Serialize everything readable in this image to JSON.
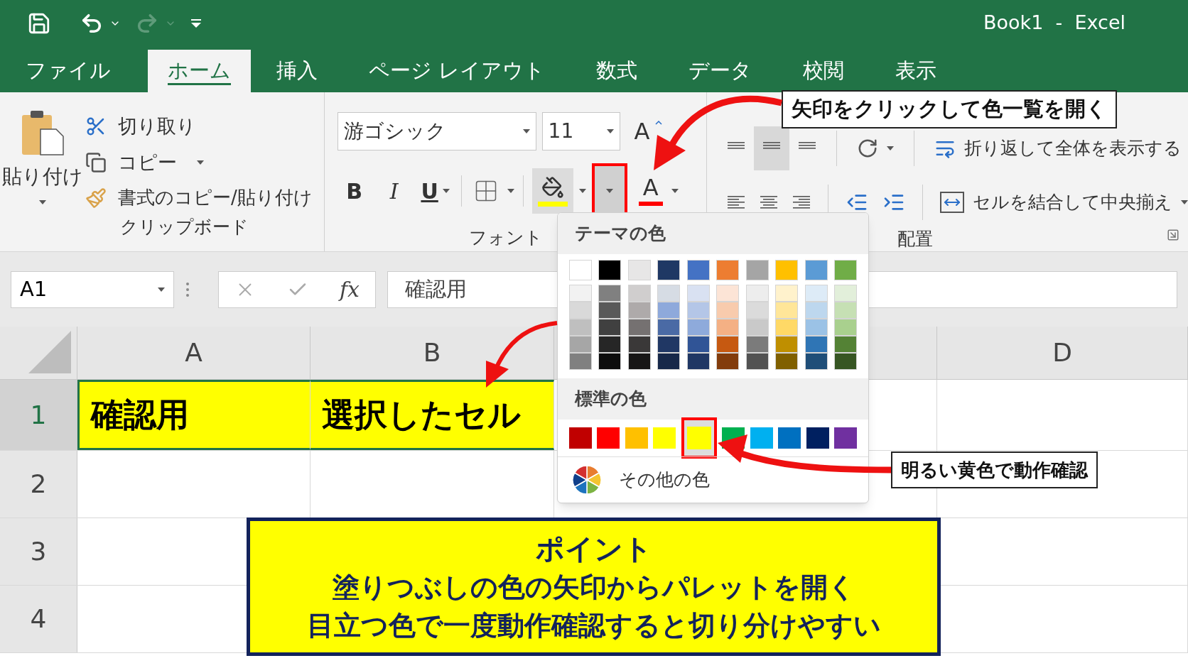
{
  "window": {
    "title": "Book1  -  Excel"
  },
  "quick_access": {
    "redo": {
      "disabled": true
    }
  },
  "tabs": [
    {
      "label": "ファイル",
      "selected": false
    },
    {
      "label": "ホーム",
      "selected": true
    },
    {
      "label": "挿入",
      "selected": false
    },
    {
      "label": "ページ レイアウト",
      "selected": false
    },
    {
      "label": "数式",
      "selected": false
    },
    {
      "label": "データ",
      "selected": false
    },
    {
      "label": "校閲",
      "selected": false
    },
    {
      "label": "表示",
      "selected": false
    }
  ],
  "ribbon": {
    "clipboard": {
      "paste": "貼り付け",
      "cut": "切り取り",
      "copy": "コピー",
      "format_painter": "書式のコピー/貼り付け",
      "label": "クリップボード"
    },
    "font": {
      "font_name": "游ゴシック",
      "font_size": "11",
      "grow_font": "A",
      "bold": "B",
      "italic": "I",
      "underline": "U",
      "fill_dropdown_highlighted": true,
      "font_color_letter": "A",
      "label": "フォント"
    },
    "alignment": {
      "wrap_text": "折り返して全体を表示する",
      "merge_center": "セルを結合して中央揃え",
      "label": "配置"
    }
  },
  "formula_bar": {
    "name_box": "A1",
    "fx": "fx",
    "value": "確認用"
  },
  "sheet": {
    "columns": [
      {
        "kind": "label",
        "label": "A"
      },
      {
        "kind": "label",
        "label": "B"
      },
      {
        "kind": "covered"
      },
      {
        "kind": "label",
        "label": "D"
      }
    ],
    "rows": [
      {
        "header": "1",
        "cells": [
          {
            "text": "確認用",
            "color": "#ffff00",
            "selected": true
          },
          {
            "text": "選択したセル",
            "color": "#ffff00",
            "selected": true
          }
        ]
      },
      {
        "header": "2"
      },
      {
        "header": "3"
      },
      {
        "header": "4"
      }
    ]
  },
  "palette": {
    "theme_title": "テーマの色",
    "theme_columns": [
      {
        "swatches": [
          {
            "color": "#ffffff"
          },
          {
            "color": "#f2f2f2"
          },
          {
            "color": "#d9d9d9"
          },
          {
            "color": "#bfbfbf"
          },
          {
            "color": "#a6a6a6"
          },
          {
            "color": "#808080"
          }
        ]
      },
      {
        "swatches": [
          {
            "color": "#000000"
          },
          {
            "color": "#808080"
          },
          {
            "color": "#595959"
          },
          {
            "color": "#404040"
          },
          {
            "color": "#262626"
          },
          {
            "color": "#0d0d0d"
          }
        ]
      },
      {
        "swatches": [
          {
            "color": "#e7e6e6"
          },
          {
            "color": "#d0cece"
          },
          {
            "color": "#aeaaaa"
          },
          {
            "color": "#757171"
          },
          {
            "color": "#3a3838"
          },
          {
            "color": "#171616"
          }
        ]
      },
      {
        "swatches": [
          {
            "color": "#1f3864"
          },
          {
            "color": "#d6dce4"
          },
          {
            "color": "#8ea9db"
          },
          {
            "color": "#4a6aa5"
          },
          {
            "color": "#203764"
          },
          {
            "color": "#172849"
          }
        ]
      },
      {
        "swatches": [
          {
            "color": "#4472c4"
          },
          {
            "color": "#d9e1f2"
          },
          {
            "color": "#b4c6e7"
          },
          {
            "color": "#8eaadb"
          },
          {
            "color": "#305496"
          },
          {
            "color": "#203764"
          }
        ]
      },
      {
        "swatches": [
          {
            "color": "#ed7d31"
          },
          {
            "color": "#fce4d6"
          },
          {
            "color": "#f8cbad"
          },
          {
            "color": "#f4b084"
          },
          {
            "color": "#c65911"
          },
          {
            "color": "#833c0c"
          }
        ]
      },
      {
        "swatches": [
          {
            "color": "#a5a5a5"
          },
          {
            "color": "#ededed"
          },
          {
            "color": "#dbdbdb"
          },
          {
            "color": "#c9c9c9"
          },
          {
            "color": "#7b7b7b"
          },
          {
            "color": "#525252"
          }
        ]
      },
      {
        "swatches": [
          {
            "color": "#ffc000"
          },
          {
            "color": "#fff2cc"
          },
          {
            "color": "#ffe699"
          },
          {
            "color": "#ffd966"
          },
          {
            "color": "#bf8f00"
          },
          {
            "color": "#806000"
          }
        ]
      },
      {
        "swatches": [
          {
            "color": "#5b9bd5"
          },
          {
            "color": "#ddebf7"
          },
          {
            "color": "#bdd7ee"
          },
          {
            "color": "#9bc2e6"
          },
          {
            "color": "#2f75b5"
          },
          {
            "color": "#1f4e78"
          }
        ]
      },
      {
        "swatches": [
          {
            "color": "#70ad47"
          },
          {
            "color": "#e2efda"
          },
          {
            "color": "#c6e0b4"
          },
          {
            "color": "#a9d08e"
          },
          {
            "color": "#548235"
          },
          {
            "color": "#375623"
          }
        ]
      }
    ],
    "standard_title": "標準の色",
    "standard": [
      {
        "color": "#c00000",
        "selected": false
      },
      {
        "color": "#ff0000",
        "selected": false
      },
      {
        "color": "#ffc000",
        "selected": false
      },
      {
        "color": "#ffff00",
        "selected": false
      },
      {
        "color": "#ffff00",
        "selected": true
      },
      {
        "color": "#00b050",
        "selected": false
      },
      {
        "color": "#00b0f0",
        "selected": false
      },
      {
        "color": "#0070c0",
        "selected": false
      },
      {
        "color": "#002060",
        "selected": false
      },
      {
        "color": "#7030a0",
        "selected": false
      }
    ],
    "more": "その他の色"
  },
  "callouts": [
    {
      "text": "矢印をクリックして色一覧を開く"
    },
    {
      "text": "明るい黄色で動作確認"
    }
  ],
  "point": {
    "title": "ポイント",
    "lines": [
      "塗りつぶしの色の矢印からパレットを開く",
      "目立つ色で一度動作確認すると切り分けやすい"
    ]
  }
}
